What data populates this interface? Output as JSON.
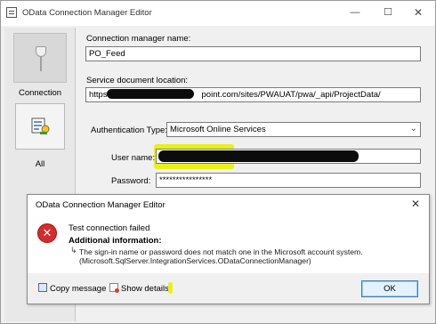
{
  "window": {
    "title": "OData Connection Manager Editor"
  },
  "nav": {
    "items": [
      {
        "label": "Connection"
      },
      {
        "label": "All"
      }
    ]
  },
  "form": {
    "connection_manager_name_label": "Connection manager name:",
    "connection_manager_name_value": "PO_Feed",
    "service_document_location_label": "Service document location:",
    "service_document_prefix": "https://",
    "service_document_suffix": "point.com/sites/PWAUAT/pwa/_api/ProjectData/",
    "authentication_type_label": "Authentication Type:",
    "authentication_type_value": "Microsoft Online Services",
    "user_name_label": "User name:",
    "password_label": "Password:",
    "password_value": "****************"
  },
  "dialog": {
    "title": "OData Connection Manager Editor",
    "heading": "Test connection failed",
    "additional_info_label": "Additional information:",
    "arrow": "↳",
    "message_line1": "The sign-in name or password does not match one in the Microsoft account system.",
    "message_line2": "(Microsoft.SqlServer.IntegrationServices.ODataConnectionManager)",
    "copy_message_label": "Copy message",
    "show_details_label": "Show details",
    "ok_label": "OK"
  },
  "colors": {
    "error_red": "#d42c2c",
    "highlight_yellow": "#e9f01a",
    "ok_border": "#3c7fb1"
  }
}
